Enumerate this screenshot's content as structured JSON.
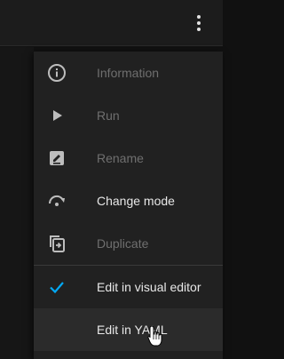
{
  "menu": {
    "items": [
      {
        "label": "Information",
        "icon": "info-icon",
        "enabled": false
      },
      {
        "label": "Run",
        "icon": "play-icon",
        "enabled": false
      },
      {
        "label": "Rename",
        "icon": "rename-icon",
        "enabled": false
      },
      {
        "label": "Change mode",
        "icon": "change-mode-icon",
        "enabled": true
      },
      {
        "label": "Duplicate",
        "icon": "duplicate-icon",
        "enabled": false
      }
    ],
    "editor_options": [
      {
        "label": "Edit in visual editor",
        "selected": true
      },
      {
        "label": "Edit in YAML",
        "selected": false
      }
    ]
  },
  "colors": {
    "accent": "#03a9f4",
    "enabled_text": "#e8e8e8",
    "disabled_text": "#6f6f6f",
    "menu_bg": "#212121",
    "hover_bg": "#2b2b2b"
  }
}
